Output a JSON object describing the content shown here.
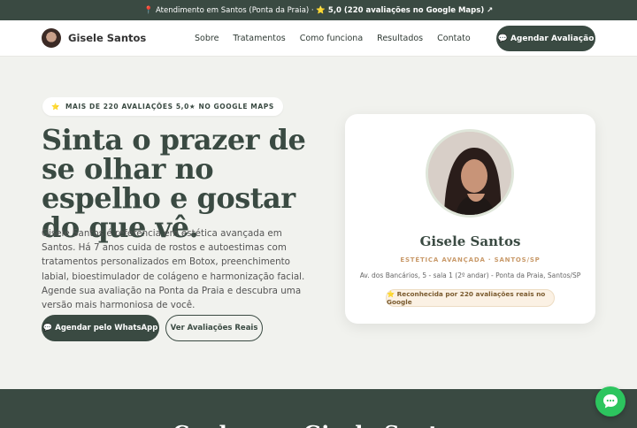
{
  "topbar": {
    "text": "📍 Atendimento em Santos (Ponta da Praia) · ⭐",
    "rating": "5,0 (220 avaliações no Google Maps) ↗"
  },
  "nav": {
    "brand": "Gisele Santos",
    "items": [
      "Sobre",
      "Tratamentos",
      "Como funciona",
      "Resultados",
      "Contato"
    ],
    "cta": "💬 Agendar Avaliação"
  },
  "hero": {
    "badge_icon": "⭐",
    "badge": "MAIS DE 220 AVALIAÇÕES 5,0★ NO GOOGLE MAPS",
    "headline": "Sinta o prazer de se olhar no espelho e gostar do que vê.",
    "description": "Gisele Santos é referência em estética avançada em Santos. Há 7 anos cuida de rostos e autoestimas com tratamentos personalizados em Botox, preenchimento labial, bioestimulador de colágeno e harmonização facial. Agende sua avaliação na Ponta da Praia e descubra uma versão mais harmoniosa de você.",
    "btn_whatsapp": "💬 Agendar pelo WhatsApp",
    "btn_reviews": "Ver Avaliações Reais"
  },
  "card": {
    "name": "Gisele Santos",
    "role": "ESTÉTICA AVANÇADA · SANTOS/SP",
    "address": "Av. dos Bancários, 5 - sala 1 (2º andar) - Ponta da Praia, Santos/SP",
    "pill": "⭐ Reconhecida por 220 avaliações reais no Google"
  },
  "footer": {
    "title": "Conheça a Gisele Santos"
  },
  "colors": {
    "primary": "#3a4a42",
    "accent": "#c99a6a",
    "whatsapp": "#2cc55e"
  }
}
